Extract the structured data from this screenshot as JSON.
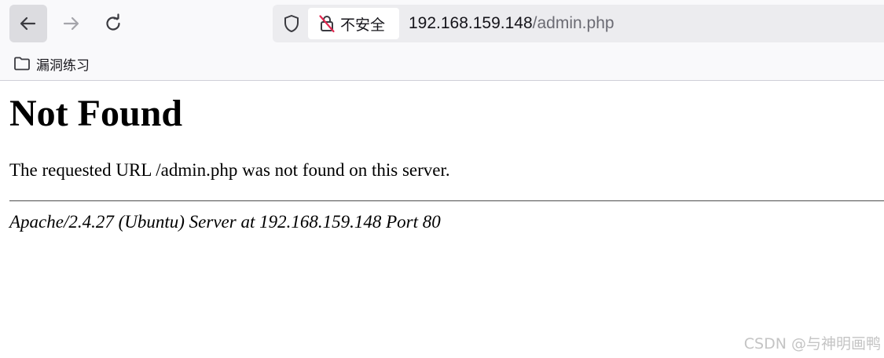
{
  "browser": {
    "security_label": "不安全",
    "url_host": "192.168.159.148",
    "url_path": "/admin.php",
    "bookmarks": [
      {
        "label": "漏洞练习"
      }
    ]
  },
  "page": {
    "heading": "Not Found",
    "message": "The requested URL /admin.php was not found on this server.",
    "server_signature": "Apache/2.4.27 (Ubuntu) Server at 192.168.159.148 Port 80"
  },
  "watermark": "CSDN @与神明画鸭"
}
